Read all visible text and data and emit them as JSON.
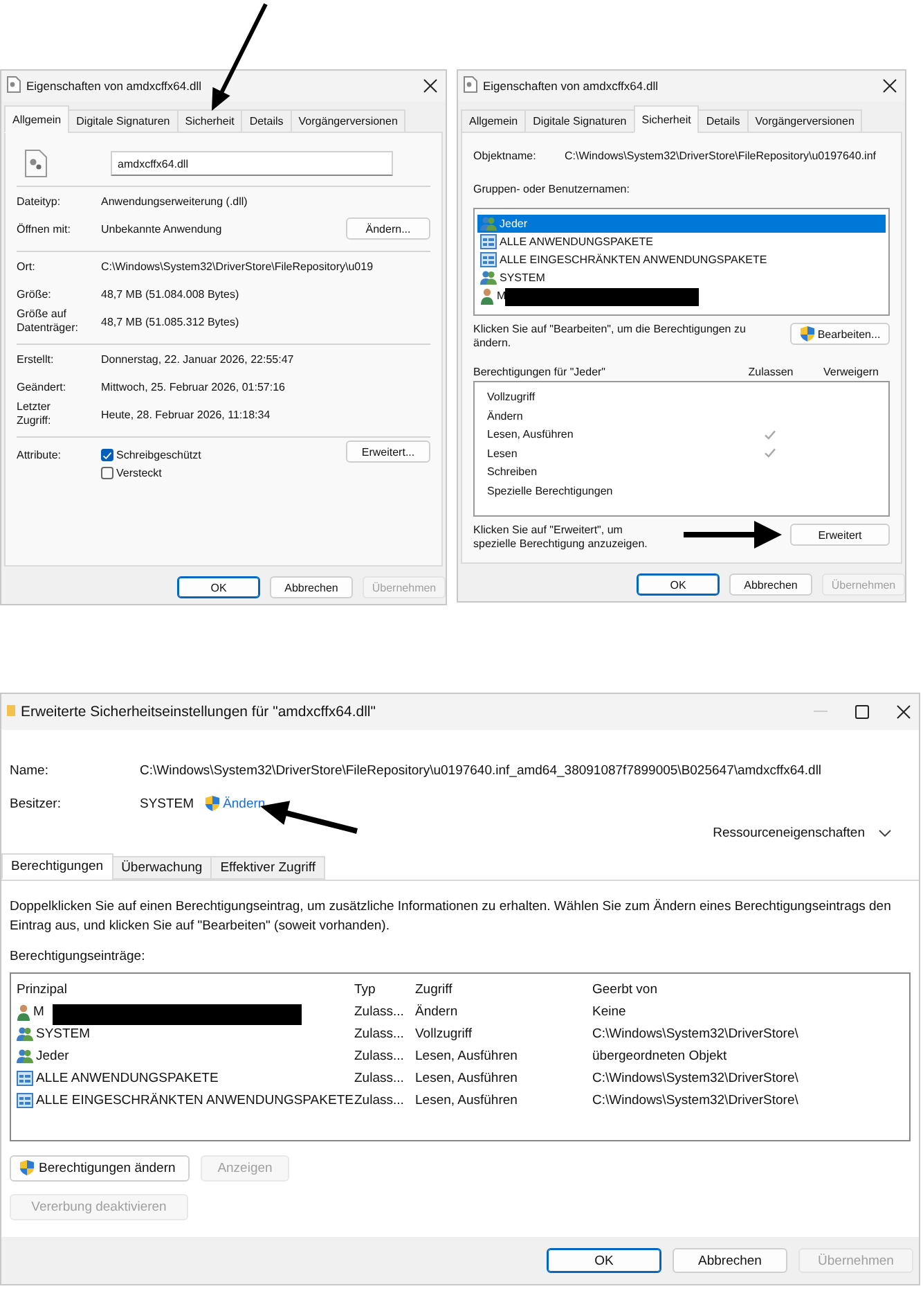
{
  "general_dialog": {
    "title": "Eigenschaften von amdxcffx64.dll",
    "tabs": [
      {
        "label": "Allgemein",
        "selected": true
      },
      {
        "label": "Digitale Signaturen",
        "selected": false
      },
      {
        "label": "Sicherheit",
        "selected": false
      },
      {
        "label": "Details",
        "selected": false
      },
      {
        "label": "Vorgängerversionen",
        "selected": false
      }
    ],
    "file_name": "amdxcffx64.dll",
    "sections": [
      [
        {
          "label": "Dateityp:",
          "value": "Anwendungserweiterung (.dll)"
        },
        {
          "label": "Öffnen mit:",
          "value": "Unbekannte Anwendung",
          "button": "Ändern..."
        }
      ],
      [
        {
          "label": "Ort:",
          "value": "C:\\Windows\\System32\\DriverStore\\FileRepository\\u019"
        },
        {
          "label": "Größe:",
          "value": "48,7 MB (51.084.008 Bytes)"
        },
        {
          "label": "Größe auf Datenträger:",
          "value": "48,7 MB (51.085.312 Bytes)"
        }
      ],
      [
        {
          "label": "Erstellt:",
          "value": "Donnerstag, 22. Januar 2026, 22:55:47"
        },
        {
          "label": "Geändert:",
          "value": "Mittwoch, 25. Februar 2026, 01:57:16"
        },
        {
          "label": "Letzter Zugriff:",
          "value": "Heute, 28. Februar 2026, 11:18:34"
        }
      ]
    ],
    "attributes": {
      "label": "Attribute:",
      "checkboxes": [
        {
          "label": "Schreibgeschützt",
          "checked": true
        },
        {
          "label": "Versteckt",
          "checked": false
        }
      ],
      "button": "Erweitert..."
    },
    "buttons": [
      {
        "label": "OK",
        "default": true,
        "disabled": false
      },
      {
        "label": "Abbrechen",
        "default": false,
        "disabled": false
      },
      {
        "label": "Übernehmen",
        "default": false,
        "disabled": true
      }
    ]
  },
  "security_dialog": {
    "title": "Eigenschaften von amdxcffx64.dll",
    "tabs": [
      {
        "label": "Allgemein",
        "selected": false
      },
      {
        "label": "Digitale Signaturen",
        "selected": false
      },
      {
        "label": "Sicherheit",
        "selected": true
      },
      {
        "label": "Details",
        "selected": false
      },
      {
        "label": "Vorgängerversionen",
        "selected": false
      }
    ],
    "object_label": "Objektname:",
    "object_name": "C:\\Windows\\System32\\DriverStore\\FileRepository\\u0197640.inf",
    "groups_label": "Gruppen- oder Benutzernamen:",
    "groups": [
      {
        "name": "Jeder",
        "kind": "group",
        "selected": true,
        "redacted": false
      },
      {
        "name": "ALLE ANWENDUNGSPAKETE",
        "kind": "package",
        "selected": false,
        "redacted": false
      },
      {
        "name": "ALLE EINGESCHRÄNKTEN ANWENDUNGSPAKETE",
        "kind": "package",
        "selected": false,
        "redacted": false
      },
      {
        "name": "SYSTEM",
        "kind": "group",
        "selected": false,
        "redacted": false
      },
      {
        "name": "M",
        "kind": "user",
        "selected": false,
        "redacted": true
      }
    ],
    "edit_hint": "Klicken Sie auf \"Bearbeiten\", um die Berechtigungen zu ändern.",
    "edit_button": "Bearbeiten...",
    "permissions_label": "Berechtigungen für \"Jeder\"",
    "allow_header": "Zulassen",
    "deny_header": "Verweigern",
    "permissions": [
      {
        "name": "Vollzugriff",
        "allow": false,
        "deny": false
      },
      {
        "name": "Ändern",
        "allow": false,
        "deny": false
      },
      {
        "name": "Lesen, Ausführen",
        "allow": true,
        "deny": false
      },
      {
        "name": "Lesen",
        "allow": true,
        "deny": false
      },
      {
        "name": "Schreiben",
        "allow": false,
        "deny": false
      },
      {
        "name": "Spezielle Berechtigungen",
        "allow": false,
        "deny": false
      }
    ],
    "advanced_hint": "Klicken Sie auf \"Erweitert\", um spezielle Berechtigung anzuzeigen.",
    "advanced_button": "Erweitert",
    "buttons": [
      {
        "label": "OK",
        "default": true,
        "disabled": false
      },
      {
        "label": "Abbrechen",
        "default": false,
        "disabled": false
      },
      {
        "label": "Übernehmen",
        "default": false,
        "disabled": true
      }
    ]
  },
  "advanced_dialog": {
    "title": "Erweiterte Sicherheitseinstellungen für \"amdxcffx64.dll\"",
    "name_label": "Name:",
    "name_value": "C:\\Windows\\System32\\DriverStore\\FileRepository\\u0197640.inf_amd64_38091087f7899005\\B025647\\amdxcffx64.dll",
    "owner_label": "Besitzer:",
    "owner": "SYSTEM",
    "owner_link": "Ändern",
    "resource_properties": "Ressourceneigenschaften",
    "tabs": [
      {
        "label": "Berechtigungen",
        "selected": true
      },
      {
        "label": "Überwachung",
        "selected": false
      },
      {
        "label": "Effektiver Zugriff",
        "selected": false
      }
    ],
    "info": "Doppelklicken Sie auf einen Berechtigungseintrag, um zusätzliche Informationen zu erhalten. Wählen Sie zum Ändern eines Berechtigungseintrags den Eintrag aus, und klicken Sie auf \"Bearbeiten\" (soweit vorhanden).",
    "entries_label": "Berechtigungseinträge:",
    "columns": [
      "Prinzipal",
      "Typ",
      "Zugriff",
      "Geerbt von"
    ],
    "rows": [
      {
        "principal": "M",
        "kind": "user",
        "redacted": true,
        "type": "Zulass...",
        "access": "Ändern",
        "inherited": "Keine"
      },
      {
        "principal": "SYSTEM",
        "kind": "group",
        "redacted": false,
        "type": "Zulass...",
        "access": "Vollzugriff",
        "inherited": "C:\\Windows\\System32\\DriverStore\\"
      },
      {
        "principal": "Jeder",
        "kind": "group",
        "redacted": false,
        "type": "Zulass...",
        "access": "Lesen, Ausführen",
        "inherited": "übergeordneten Objekt"
      },
      {
        "principal": "ALLE ANWENDUNGSPAKETE",
        "kind": "package",
        "redacted": false,
        "type": "Zulass...",
        "access": "Lesen, Ausführen",
        "inherited": "C:\\Windows\\System32\\DriverStore\\"
      },
      {
        "principal": "ALLE EINGESCHRÄNKTEN ANWENDUNGSPAKETE",
        "kind": "package",
        "redacted": false,
        "type": "Zulass...",
        "access": "Lesen, Ausführen",
        "inherited": "C:\\Windows\\System32\\DriverStore\\"
      }
    ],
    "change_button": {
      "label": "Berechtigungen ändern",
      "disabled": false
    },
    "view_button": {
      "label": "Anzeigen",
      "disabled": true
    },
    "inheritance_button": {
      "label": "Vererbung deaktivieren",
      "disabled": true
    },
    "buttons": [
      {
        "label": "OK",
        "default": true,
        "disabled": false
      },
      {
        "label": "Abbrechen",
        "default": false,
        "disabled": false
      },
      {
        "label": "Übernehmen",
        "default": false,
        "disabled": true
      }
    ]
  }
}
